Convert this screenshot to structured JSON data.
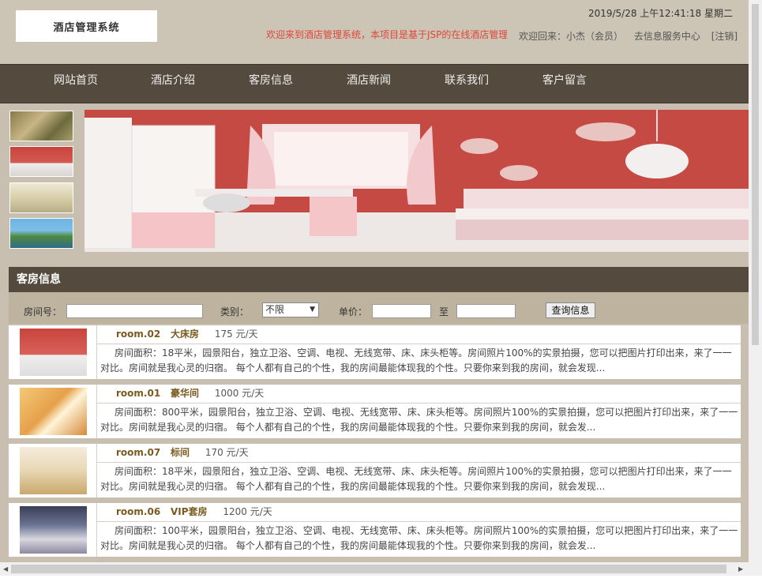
{
  "header": {
    "logo_text": "酒店管理系统",
    "datetime": "2019/5/28 上午12:41:18 星期二",
    "marquee": "欢迎来到酒店管理系统，本项目是基于JSP的在线酒店管理",
    "welcome": "欢迎回来：小杰（会员）",
    "service_link": "去信息服务中心",
    "logout_link": "[注销]"
  },
  "nav": {
    "items": [
      {
        "label": "网站首页"
      },
      {
        "label": "酒店介绍"
      },
      {
        "label": "客房信息"
      },
      {
        "label": "酒店新闻"
      },
      {
        "label": "联系我们"
      },
      {
        "label": "客户留言"
      }
    ]
  },
  "rooms_panel": {
    "title": "客房信息",
    "search": {
      "room_no_label": "房间号：",
      "room_no_value": "",
      "type_label": "类别：",
      "type_selected": "不限",
      "price_label": "单价：",
      "price_from": "",
      "to_label": "至",
      "price_to": "",
      "query_button": "查询信息"
    },
    "rooms": [
      {
        "no": "room.02",
        "name": "大床房",
        "price": "175 元/天",
        "desc": "房间面积：18平米，园景阳台，独立卫浴、空调、电视、无线宽带、床、床头柜等。房间照片100%的实景拍摄，您可以把图片打印出来，来了一一对比。房间就是我心灵的归宿。 每个人都有自己的个性，我的房间最能体现我的个性。只要你来到我的房间，就会发现..."
      },
      {
        "no": "room.01",
        "name": "豪华间",
        "price": "1000 元/天",
        "desc": "房间面积：800平米，园景阳台，独立卫浴、空调、电视、无线宽带、床、床头柜等。房间照片100%的实景拍摄，您可以把图片打印出来，来了一一对比。房间就是我心灵的归宿。 每个人都有自己的个性，我的房间最能体现我的个性。只要你来到我的房间，就会发..."
      },
      {
        "no": "room.07",
        "name": "标间",
        "price": "170 元/天",
        "desc": "房间面积：18平米，园景阳台，独立卫浴、空调、电视、无线宽带、床、床头柜等。房间照片100%的实景拍摄，您可以把图片打印出来，来了一一对比。房间就是我心灵的归宿。 每个人都有自己的个性，我的房间最能体现我的个性。只要你来到我的房间，就会发现..."
      },
      {
        "no": "room.06",
        "name": "VIP套房",
        "price": "1200 元/天",
        "desc": "房间面积：100平米，园景阳台，独立卫浴、空调、电视、无线宽带、床、床头柜等。房间照片100%的实景拍摄，您可以把图片打印出来，来了一一对比。房间就是我心灵的归宿。 每个人都有自己的个性，我的房间最能体现我的个性。只要你来到我的房间，就会发..."
      }
    ]
  },
  "colors": {
    "nav_bg": "#554a3e",
    "page_bg": "#c9bfb0",
    "marquee": "#e0453a",
    "room_title": "#7a5a1e"
  }
}
